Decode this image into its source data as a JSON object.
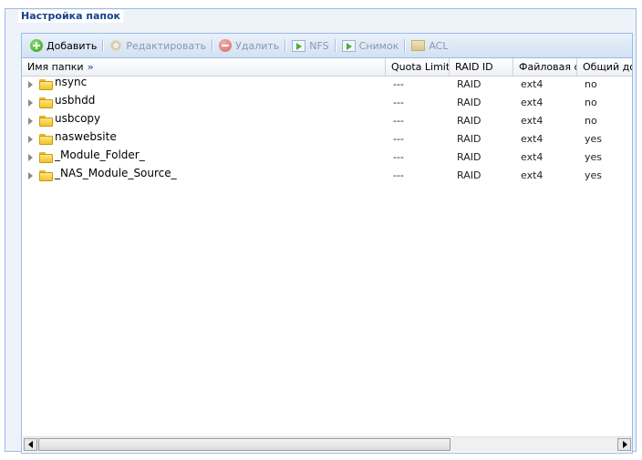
{
  "fieldset": {
    "title": "Настройка папок"
  },
  "toolbar": {
    "add_label": "Добавить",
    "edit_label": "Редактировать",
    "delete_label": "Удалить",
    "nfs_label": "NFS",
    "snapshot_label": "Снимок",
    "acl_label": "ACL"
  },
  "columns": {
    "name": "Имя папки",
    "name_expand": "»",
    "quota": "Quota Limit",
    "raid": "RAID ID",
    "fs": "Файловая си",
    "public": "Общий до"
  },
  "rows": [
    {
      "name": "nsync",
      "quota": "---",
      "raid": "RAID",
      "fs": "ext4",
      "public": "no"
    },
    {
      "name": "usbhdd",
      "quota": "---",
      "raid": "RAID",
      "fs": "ext4",
      "public": "no"
    },
    {
      "name": "usbcopy",
      "quota": "---",
      "raid": "RAID",
      "fs": "ext4",
      "public": "no"
    },
    {
      "name": "naswebsite",
      "quota": "---",
      "raid": "RAID",
      "fs": "ext4",
      "public": "yes"
    },
    {
      "name": "_Module_Folder_",
      "quota": "---",
      "raid": "RAID",
      "fs": "ext4",
      "public": "yes"
    },
    {
      "name": "_NAS_Module_Source_",
      "quota": "---",
      "raid": "RAID",
      "fs": "ext4",
      "public": "yes"
    }
  ],
  "colors": {
    "border": "#99bbe8",
    "legend": "#15428b",
    "disabled_text": "#8a98aa"
  }
}
